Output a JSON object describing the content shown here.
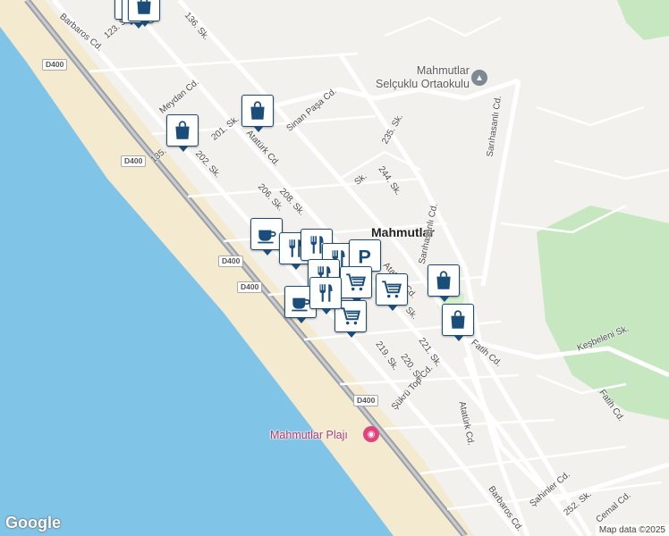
{
  "map": {
    "colors": {
      "sea": "#80c4e8",
      "sand": "#f4ead0",
      "land": "#f3f1ee",
      "green": "#c7e7c0",
      "road": "#ffffff",
      "highway": "#9aa0a6",
      "pin_border": "#1a4d7a"
    },
    "poi_labels": {
      "school": "Mahmutlar\nSelçuklu Ortaokulu",
      "beach": "Mahmutlar Plajı",
      "place": "Mahmutlar"
    },
    "road_shields": [
      "D400",
      "D400",
      "D400",
      "D400",
      "D400"
    ],
    "street_labels": [
      "Barbaros Cd.",
      "123. Sk.",
      "136. Sk.",
      "Meydan Cd.",
      "Sinan Paşa Cd.",
      "201. Sk.",
      "Atatürk Cd.",
      "202. Sk.",
      "135.",
      "206. Sk.",
      "208. Sk.",
      "235. Sk.",
      "244. Sk.",
      "Sk.",
      "Sarıhasanlı Cd.",
      "Sarıhasanlı Cd.",
      "Atatürk Cd.",
      "Sk.",
      "219. Sk.",
      "220. Sk.",
      "221. Sk.",
      "Fatih Cd.",
      "Keşbeleni Sk.",
      "Fatih Cd.",
      "Şükrü Top Cd.",
      "Atatürk Cd.",
      "Barbaros Cd.",
      "Şahinler Cd.",
      "252. Sk.",
      "Cemal Cd."
    ],
    "markers": [
      {
        "type": "shopping"
      },
      {
        "type": "shopping"
      },
      {
        "type": "shopping"
      },
      {
        "type": "shopping"
      },
      {
        "type": "shopping"
      },
      {
        "type": "coffee"
      },
      {
        "type": "restaurant"
      },
      {
        "type": "restaurant"
      },
      {
        "type": "restaurant"
      },
      {
        "type": "parking"
      },
      {
        "type": "restaurant"
      },
      {
        "type": "grocery"
      },
      {
        "type": "grocery"
      },
      {
        "type": "grocery"
      },
      {
        "type": "coffee"
      },
      {
        "type": "restaurant"
      },
      {
        "type": "shopping"
      },
      {
        "type": "shopping"
      }
    ],
    "attribution": {
      "logo": "Google",
      "text": "Map data ©2025"
    }
  }
}
